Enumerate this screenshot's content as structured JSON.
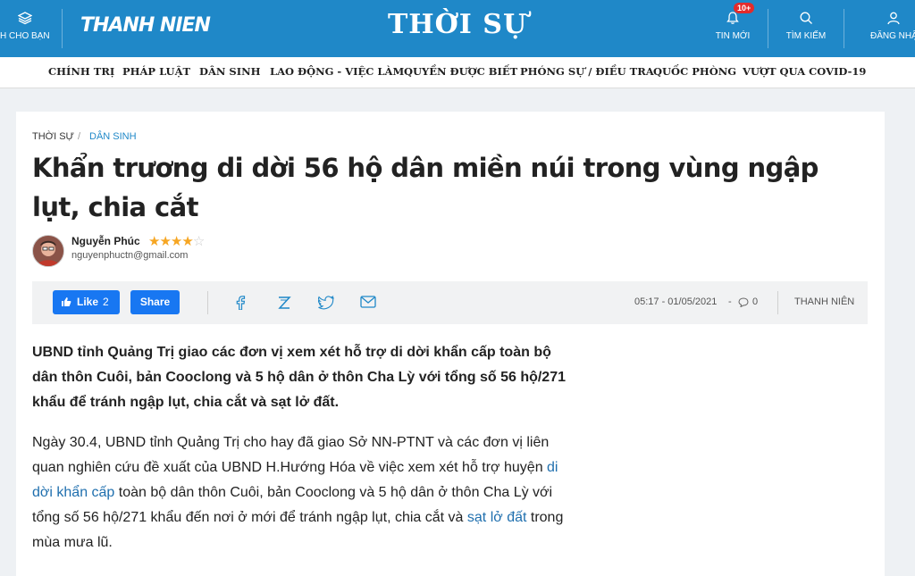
{
  "topbar": {
    "for_you_label": "H CHO BẠN",
    "logo_text": "THANH NIEN",
    "section_title": "THỜI SỰ",
    "news_label": "TIN MỚI",
    "news_badge": "10+",
    "search_label": "TÌM KIẾM",
    "login_label": "ĐĂNG NHẬ"
  },
  "nav": {
    "items": [
      "CHÍNH TRỊ",
      "PHÁP LUẬT",
      "DÂN SINH",
      "LAO ĐỘNG - VIỆC LÀM",
      "QUYỀN ĐƯỢC BIẾT",
      "PHÓNG SỰ / ĐIỀU TRA",
      "QUỐC PHÒNG",
      "VƯỢT QUA COVID-19"
    ]
  },
  "breadcrumb": {
    "section": "THỜI SỰ",
    "separator": "/",
    "subsection": "DÂN SINH"
  },
  "article": {
    "title": "Khẩn trương di dời 56 hộ dân miền núi trong vùng ngập lụt, chia cắt",
    "author": "Nguyễn Phúc",
    "email": "nguyenphuctn@gmail.com",
    "rating": 4,
    "rating_max": 5,
    "timestamp": "05:17 - 01/05/2021",
    "comment_count": "0",
    "source": "THANH NIÊN",
    "sapo": "UBND tỉnh Quảng Trị giao các đơn vị xem xét hỗ trợ di dời khẩn cấp toàn bộ dân thôn Cuôi, bản Cooclong và 5 hộ dân ở thôn Cha Lỳ với tổng số 56 hộ/271 khẩu để tránh ngập lụt, chia cắt và sạt lở đất.",
    "body_part1": "Ngày 30.4, UBND tỉnh Quảng Trị cho hay đã giao Sở NN-PTNT và các đơn vị liên quan nghiên cứu đề xuất của UBND H.Hướng Hóa về việc xem xét hỗ trợ huyện ",
    "body_link1": "di dời khẩn cấp",
    "body_part2": " toàn bộ dân thôn Cuôi, bản Cooclong và 5 hộ dân ở thôn Cha Lỳ với tổng số 56 hộ/271 khẩu đến nơi ở mới để tránh ngập lụt, chia cắt và ",
    "body_link2": "sạt lở đất",
    "body_part3": " trong mùa mưa lũ."
  },
  "share": {
    "like_label": "Like",
    "like_count": "2",
    "share_label": "Share"
  },
  "colors": {
    "brand_blue": "#1f88c8",
    "facebook_blue": "#1877f2",
    "link": "#1f6fae",
    "star": "#f6a623"
  },
  "icons": [
    "layers-icon",
    "bell-icon",
    "search-icon",
    "user-icon",
    "thumbs-up-icon",
    "facebook-icon",
    "zalo-icon",
    "twitter-icon",
    "mail-icon",
    "comment-icon"
  ]
}
